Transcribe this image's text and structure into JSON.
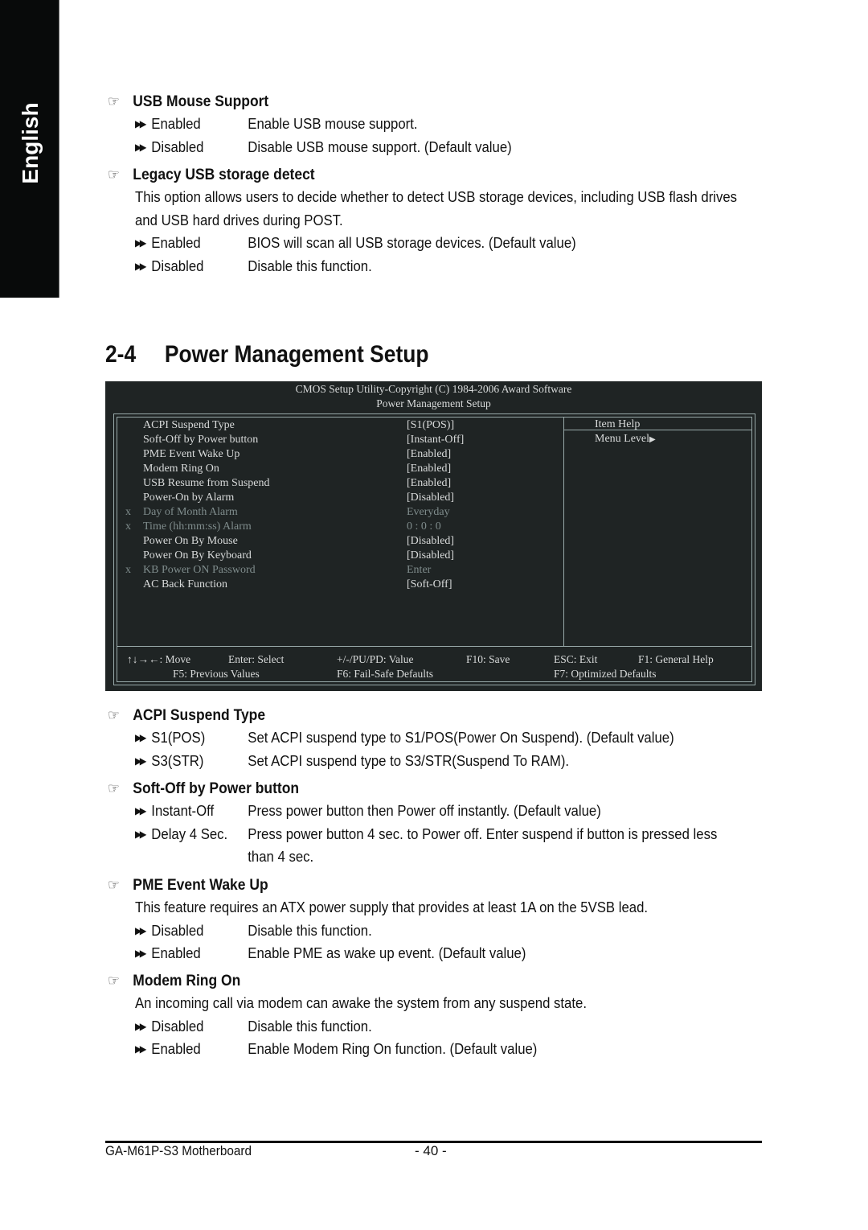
{
  "language_tab": "English",
  "sections_top": [
    {
      "title": "USB Mouse Support",
      "options": [
        {
          "key": "Enabled",
          "desc": "Enable USB mouse support."
        },
        {
          "key": "Disabled",
          "desc": "Disable USB mouse support. (Default value)"
        }
      ]
    },
    {
      "title": "Legacy USB storage detect",
      "description": "This option allows users to decide whether to detect USB storage devices, including USB flash drives and USB hard drives during POST.",
      "options": [
        {
          "key": "Enabled",
          "desc": "BIOS will scan all USB storage devices. (Default value)"
        },
        {
          "key": "Disabled",
          "desc": "Disable this function."
        }
      ]
    }
  ],
  "heading": {
    "number": "2-4",
    "text": "Power Management Setup"
  },
  "bios": {
    "header_line1": "CMOS Setup Utility-Copyright (C) 1984-2006 Award Software",
    "header_line2": "Power Management Setup",
    "items": [
      {
        "marker": "",
        "label": "ACPI Suspend Type",
        "value": "[S1(POS)]",
        "disabled": false
      },
      {
        "marker": "",
        "label": "Soft-Off by Power button",
        "value": "[Instant-Off]",
        "disabled": false
      },
      {
        "marker": "",
        "label": "PME Event Wake Up",
        "value": "[Enabled]",
        "disabled": false
      },
      {
        "marker": "",
        "label": "Modem Ring On",
        "value": "[Enabled]",
        "disabled": false
      },
      {
        "marker": "",
        "label": "USB Resume from Suspend",
        "value": "[Enabled]",
        "disabled": false
      },
      {
        "marker": "",
        "label": "Power-On by Alarm",
        "value": "[Disabled]",
        "disabled": false
      },
      {
        "marker": "x",
        "label": "Day of Month Alarm",
        "value": "Everyday",
        "disabled": true
      },
      {
        "marker": "x",
        "label": "Time (hh:mm:ss) Alarm",
        "value": "0 : 0 : 0",
        "disabled": true
      },
      {
        "marker": "",
        "label": "Power On By Mouse",
        "value": "[Disabled]",
        "disabled": false
      },
      {
        "marker": "",
        "label": "Power On By Keyboard",
        "value": "[Disabled]",
        "disabled": false
      },
      {
        "marker": "x",
        "label": "KB Power ON Password",
        "value": "Enter",
        "disabled": true
      },
      {
        "marker": "",
        "label": "AC Back Function",
        "value": "[Soft-Off]",
        "disabled": false
      }
    ],
    "help_title": "Item Help",
    "help_menu_level": "Menu Level",
    "help_arrow": "▶",
    "footer_row1": [
      "↑↓→←: Move",
      "Enter: Select",
      "+/-/PU/PD: Value",
      "F10: Save",
      "ESC: Exit",
      "F1: General Help"
    ],
    "footer_row2": [
      "F5: Previous Values",
      "F6: Fail-Safe Defaults",
      "F7: Optimized Defaults"
    ]
  },
  "sections_bottom": [
    {
      "title": "ACPI Suspend Type",
      "options": [
        {
          "key": "S1(POS)",
          "desc": "Set ACPI suspend type to S1/POS(Power On Suspend). (Default value)"
        },
        {
          "key": "S3(STR)",
          "desc": "Set ACPI suspend type to S3/STR(Suspend To RAM)."
        }
      ]
    },
    {
      "title": "Soft-Off by Power button",
      "options": [
        {
          "key": "Instant-Off",
          "desc": "Press power button then Power off instantly. (Default value)"
        },
        {
          "key": "Delay 4 Sec.",
          "desc": "Press power button 4 sec. to Power off. Enter suspend if button is pressed less than 4 sec."
        }
      ]
    },
    {
      "title": "PME Event Wake Up",
      "description": "This feature requires an ATX power supply that provides at least 1A on the 5VSB lead.",
      "options": [
        {
          "key": "Disabled",
          "desc": "Disable this function."
        },
        {
          "key": "Enabled",
          "desc": "Enable PME as wake up event. (Default value)"
        }
      ]
    },
    {
      "title": "Modem Ring On",
      "description": "An incoming call via modem can awake the system from any suspend state.",
      "options": [
        {
          "key": "Disabled",
          "desc": "Disable this function."
        },
        {
          "key": "Enabled",
          "desc": "Enable Modem Ring On function. (Default value)"
        }
      ]
    }
  ],
  "icons": {
    "section_bullet": "pointing-hand",
    "option_bullet": "double-arrow",
    "hand_glyph": "☞",
    "arrow_glyph": "▶▶"
  },
  "footer": {
    "model": "GA-M61P-S3 Motherboard",
    "page": "- 40 -"
  }
}
